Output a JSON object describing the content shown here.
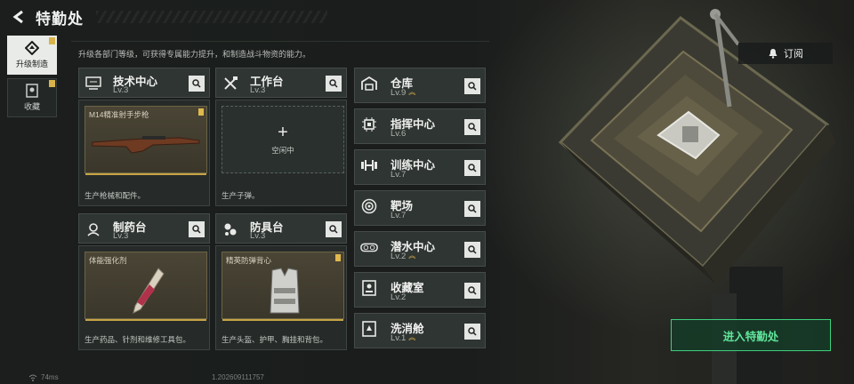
{
  "header": {
    "title": "特勤处"
  },
  "nav": [
    {
      "label": "升级制造",
      "active": true,
      "badge": true
    },
    {
      "label": "收藏",
      "active": false,
      "badge": true
    }
  ],
  "intro": "升级各部门等级，可获得专属能力提升，和制造战斗物资的能力。",
  "workshops": [
    {
      "name": "技术中心",
      "level": "Lv.3",
      "icon": "monitor-icon",
      "slot": {
        "state": "item",
        "item_name": "M14精准射手步枪"
      },
      "desc": "生产枪械和配件。"
    },
    {
      "name": "工作台",
      "level": "Lv.3",
      "icon": "tools-icon",
      "slot": {
        "state": "empty",
        "label": "空闲中"
      },
      "desc": "生产子弹。"
    },
    {
      "name": "制药台",
      "level": "Lv.3",
      "icon": "microscope-icon",
      "slot": {
        "state": "item",
        "item_name": "体能强化剂"
      },
      "desc": "生产药品、针剂和维修工具包。"
    },
    {
      "name": "防具台",
      "level": "Lv.3",
      "icon": "armor-icon",
      "slot": {
        "state": "item",
        "item_name": "精英防弹背心"
      },
      "desc": "生产头盔、护甲、胸挂和背包。"
    }
  ],
  "facilities": [
    {
      "name": "仓库",
      "level": "Lv.9",
      "upgradable": true,
      "icon": "warehouse-icon"
    },
    {
      "name": "指挥中心",
      "level": "Lv.6",
      "upgradable": false,
      "icon": "chip-icon"
    },
    {
      "name": "训练中心",
      "level": "Lv.7",
      "upgradable": false,
      "icon": "dumbbell-icon"
    },
    {
      "name": "靶场",
      "level": "Lv.7",
      "upgradable": false,
      "icon": "target-icon"
    },
    {
      "name": "潜水中心",
      "level": "Lv.2",
      "upgradable": true,
      "icon": "diving-icon"
    },
    {
      "name": "收藏室",
      "level": "Lv.2",
      "upgradable": false,
      "icon": "collection-icon"
    },
    {
      "name": "洗消舱",
      "level": "Lv.1",
      "upgradable": true,
      "icon": "decontamination-icon"
    }
  ],
  "subscribe_label": "订阅",
  "enter_label": "进入特勤处",
  "footer": {
    "ping": "74ms",
    "build": "1.202609111757"
  },
  "colors": {
    "accent_green": "#3cd07e",
    "badge_gold": "#d9b44a"
  }
}
